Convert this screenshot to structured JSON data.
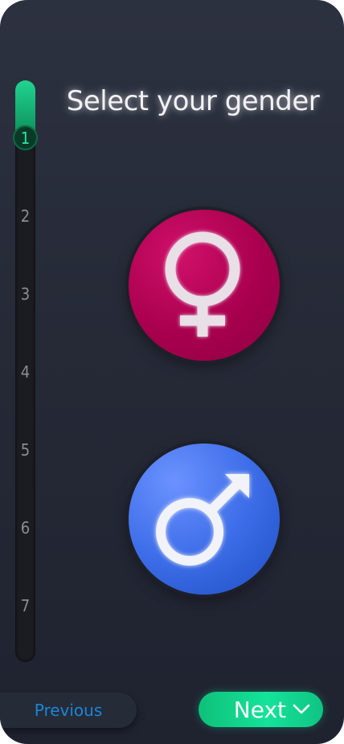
{
  "title": "Select your gender",
  "stepper": {
    "current_step": 1,
    "steps": [
      "1",
      "2",
      "3",
      "4",
      "5",
      "6",
      "7"
    ]
  },
  "options": {
    "female": {
      "icon": "female-symbol-icon",
      "color": "#b0004f"
    },
    "male": {
      "icon": "male-symbol-icon",
      "color": "#3a6be6"
    }
  },
  "nav": {
    "previous_label": "Previous",
    "next_label": "Next",
    "next_icon": "chevron-down-icon"
  },
  "colors": {
    "accent_green": "#14e39a",
    "previous_blue": "#1a86d8",
    "background": "#262a37"
  }
}
